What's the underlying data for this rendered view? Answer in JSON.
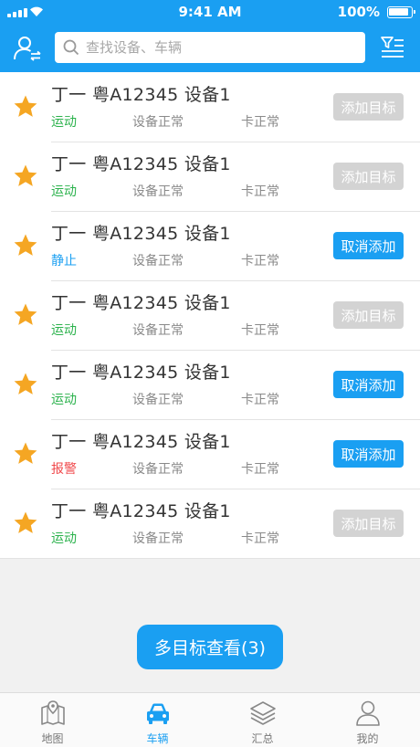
{
  "status_bar": {
    "time": "9:41 AM",
    "battery": "100%"
  },
  "header": {
    "user_icon": "user-switch-icon",
    "search_placeholder": "查找设备、车辆",
    "search_value": "",
    "filter_icon": "filter-list-icon"
  },
  "items": [
    {
      "title": "丁一 粤A12345 设备1",
      "state": "运动",
      "state_color": "#2bb24c",
      "device": "设备正常",
      "card": "卡正常",
      "action": "添加目标",
      "action_style": "gray"
    },
    {
      "title": "丁一 粤A12345 设备1",
      "state": "运动",
      "state_color": "#2bb24c",
      "device": "设备正常",
      "card": "卡正常",
      "action": "添加目标",
      "action_style": "gray"
    },
    {
      "title": "丁一 粤A12345 设备1",
      "state": "静止",
      "state_color": "#1a9ff2",
      "device": "设备正常",
      "card": "卡正常",
      "action": "取消添加",
      "action_style": "blue"
    },
    {
      "title": "丁一 粤A12345 设备1",
      "state": "运动",
      "state_color": "#2bb24c",
      "device": "设备正常",
      "card": "卡正常",
      "action": "添加目标",
      "action_style": "gray"
    },
    {
      "title": "丁一 粤A12345 设备1",
      "state": "运动",
      "state_color": "#2bb24c",
      "device": "设备正常",
      "card": "卡正常",
      "action": "取消添加",
      "action_style": "blue"
    },
    {
      "title": "丁一 粤A12345 设备1",
      "state": "报警",
      "state_color": "#f0484b",
      "device": "设备正常",
      "card": "卡正常",
      "action": "取消添加",
      "action_style": "blue"
    },
    {
      "title": "丁一 粤A12345 设备1",
      "state": "运动",
      "state_color": "#2bb24c",
      "device": "设备正常",
      "card": "卡正常",
      "action": "添加目标",
      "action_style": "gray"
    }
  ],
  "multi_button": "多目标查看(3)",
  "tabs": [
    {
      "label": "地图",
      "icon": "map-icon",
      "active": false
    },
    {
      "label": "车辆",
      "icon": "car-icon",
      "active": true
    },
    {
      "label": "汇总",
      "icon": "layers-icon",
      "active": false
    },
    {
      "label": "我的",
      "icon": "person-icon",
      "active": false
    }
  ],
  "colors": {
    "primary": "#1a9ff2",
    "star": "#f5a623",
    "disabled": "#d3d3d3"
  }
}
